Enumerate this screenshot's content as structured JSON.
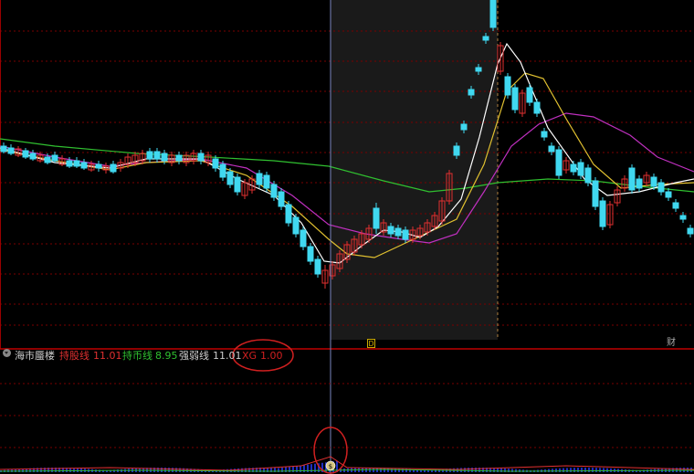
{
  "colors": {
    "background": "#000000",
    "grid": "#7a0000",
    "divider": "#c00000",
    "up": "#e03030",
    "down": "#40d8f0",
    "ma_white": "#ffffff",
    "ma_yellow": "#e0c030",
    "ma_purple": "#c030c0",
    "ma_green": "#30c030",
    "crosshair": "#7a86c0",
    "highlight": "#1a1a1a",
    "annotation": "#d02020"
  },
  "indicator": {
    "name": "海市蜃楼",
    "items": [
      {
        "label": "持股线",
        "value": "11.01",
        "color": "#e03030"
      },
      {
        "label": "持币线",
        "value": "8.95",
        "color": "#30c030"
      },
      {
        "label": "强弱线",
        "value": "11.01",
        "color": "#cccccc"
      },
      {
        "label": "XG",
        "value": "1.00",
        "color": "#d02020"
      }
    ]
  },
  "markers": {
    "d": "D",
    "cai": "财",
    "signal": "$"
  }
}
